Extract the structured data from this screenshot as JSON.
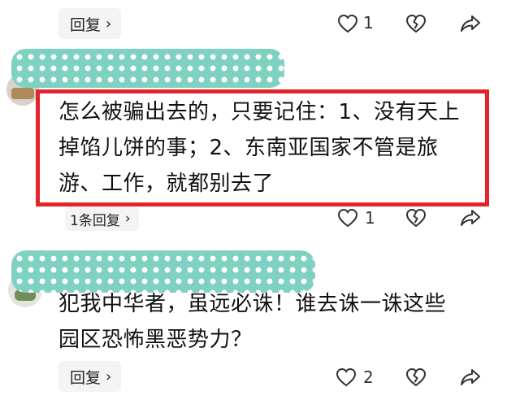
{
  "comments": [
    {
      "reply_button": "回复",
      "chevron": "›",
      "like_count": "1"
    },
    {
      "text_lines": [
        "怎么被骗出去的，只要记住：1、没有天上",
        "掉馅儿饼的事；2、东南亚国家不管是旅",
        "游、工作，就都别去了"
      ],
      "reply_button": "1条回复",
      "chevron": "›",
      "like_count": "1"
    },
    {
      "text_lines": [
        "犯我中华者，虽远必诛！谁去诛一诛这些",
        "园区恐怖黑恶势力？"
      ],
      "reply_button": "回复",
      "chevron": "›",
      "like_count": "2"
    }
  ],
  "icons": [
    "heart-outline-icon",
    "broken-heart-icon",
    "share-arrow-icon"
  ],
  "colors": {
    "highlight_border": "#e3242b",
    "redaction_teal": "#7fd1c2",
    "pill_bg": "#f4f4f4"
  }
}
